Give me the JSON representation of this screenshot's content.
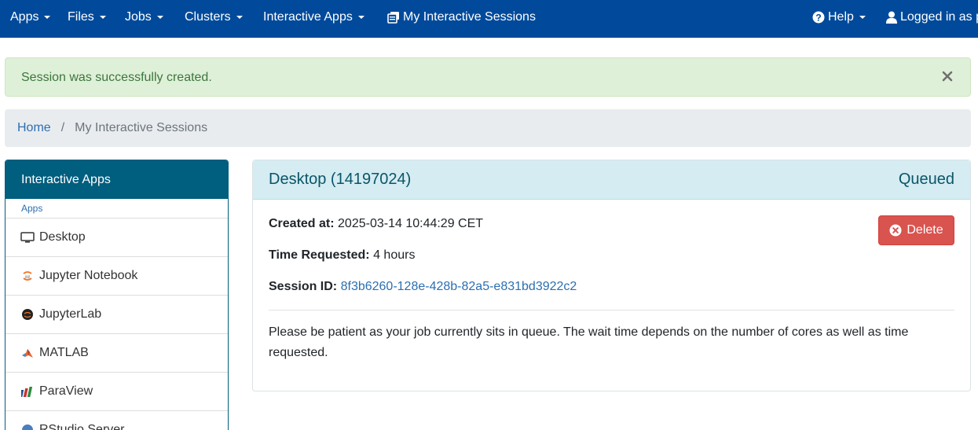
{
  "navbar": {
    "items": [
      {
        "label": "Apps",
        "icon": ""
      },
      {
        "label": "Files",
        "icon": ""
      },
      {
        "label": "Jobs",
        "icon": ""
      },
      {
        "label": "Clusters",
        "icon": ""
      },
      {
        "label": "Interactive Apps",
        "icon": ""
      },
      {
        "label": "My Interactive Sessions",
        "icon": "sessions-icon"
      }
    ],
    "help_label": "Help",
    "user_label": "Logged in as p",
    "bg_color": "#014a9b"
  },
  "alert": {
    "message": "Session was successfully created.",
    "close_icon": "close-icon"
  },
  "breadcrumb": {
    "home": "Home",
    "separator": "/",
    "current": "My Interactive Sessions"
  },
  "sidebar": {
    "title": "Interactive Apps",
    "section": "Apps",
    "items": [
      {
        "label": "Desktop",
        "icon": "monitor-icon"
      },
      {
        "label": "Jupyter Notebook",
        "icon": "jupyter-icon"
      },
      {
        "label": "JupyterLab",
        "icon": "jupyterlab-icon"
      },
      {
        "label": "MATLAB",
        "icon": "matlab-icon"
      },
      {
        "label": "ParaView",
        "icon": "paraview-icon"
      },
      {
        "label": "RStudio Server",
        "icon": "rstudio-icon"
      }
    ]
  },
  "session": {
    "title": "Desktop (14197024)",
    "status": "Queued",
    "created_label": "Created at:",
    "created_value": "2025-03-14 10:44:29 CET",
    "time_label": "Time Requested:",
    "time_value": "4 hours",
    "id_label": "Session ID:",
    "id_value": "8f3b6260-128e-428b-82a5-e831bd3922c2",
    "message": "Please be patient as your job currently sits in queue. The wait time depends on the number of cores as well as time requested.",
    "delete_label": "Delete",
    "delete_color": "#d9534f"
  }
}
